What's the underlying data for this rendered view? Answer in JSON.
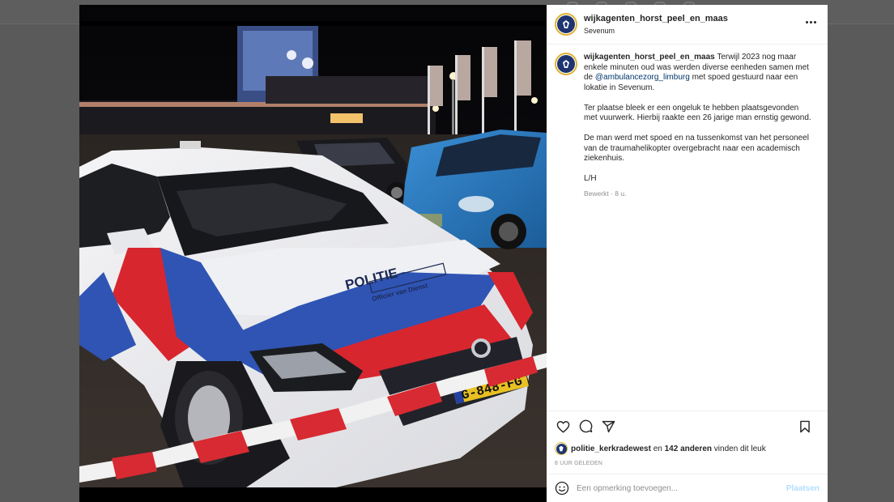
{
  "post": {
    "username": "wijkagenten_horst_peel_en_maas",
    "location": "Sevenum",
    "caption": {
      "username": "wijkagenten_horst_peel_en_maas",
      "p1_before": "Terwijl 2023 nog maar enkele minuten oud was werden diverse eenheden samen met de",
      "mention": "@ambulancezorg_limburg",
      "p1_after": "met spoed gestuurd naar een lokatie in Sevenum.",
      "p2": "Ter plaatse bleek er een ongeluk te hebben plaatsgevonden met vuurwerk. Hierbij raakte een 26 jarige man ernstig gewond.",
      "p3": "De man werd met spoed en na tussenkomst van het personeel van de traumahelikopter overgebracht naar een academisch ziekenhuis.",
      "p4": "L/H",
      "meta": "Bewerkt · 8 u."
    },
    "likes": {
      "user": "politie_kerkradewest",
      "connector": "en",
      "others": "142 anderen",
      "suffix": "vinden dit leuk"
    },
    "timestamp": "8 UUR GELEDEN",
    "comment": {
      "placeholder": "Een opmerking toevoegen...",
      "post_label": "Plaatsen"
    }
  },
  "photo": {
    "car_text": "POLITIE",
    "car_subtext": "Officier van Dienst",
    "plate": "G-848-FG"
  },
  "icons": {
    "more": "more-options-icon",
    "like": "heart-icon",
    "comment": "comment-icon",
    "share": "share-icon",
    "save": "bookmark-icon",
    "emoji": "emoji-icon"
  },
  "colors": {
    "mention": "#00376b",
    "post_button": "#b2dffc",
    "avatar_ring": "#e0b230",
    "police_blue": "#1d3470",
    "police_red": "#d8262f"
  }
}
